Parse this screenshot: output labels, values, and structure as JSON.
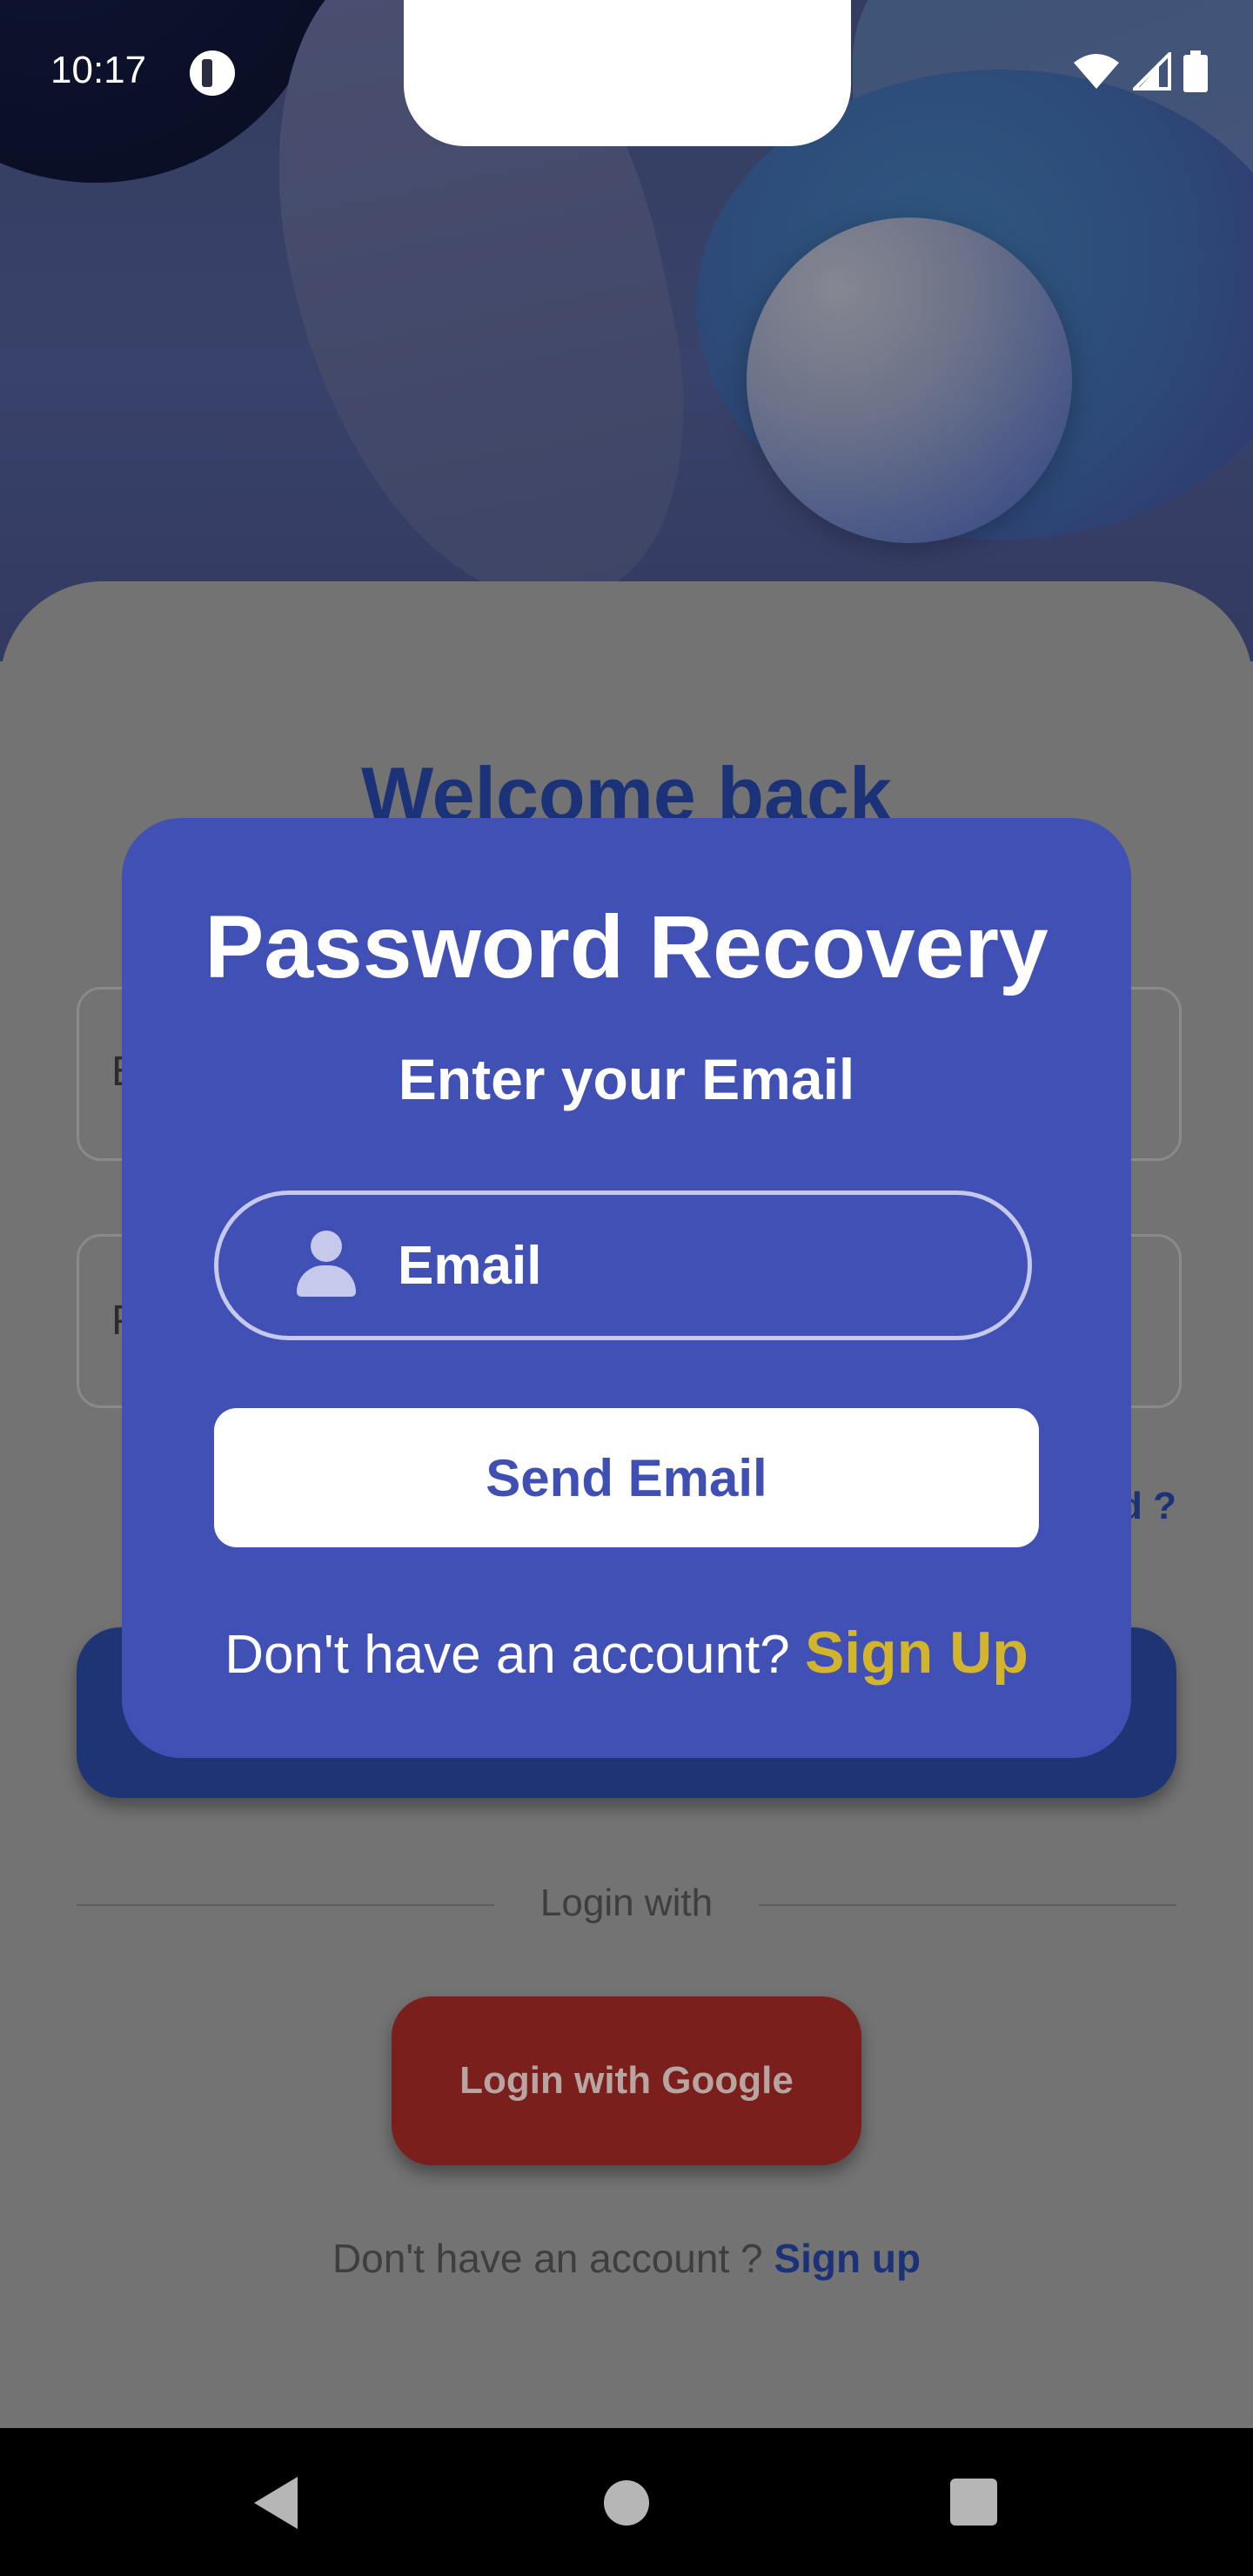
{
  "status_bar": {
    "time": "10:17"
  },
  "login_screen": {
    "welcome_title": "Welcome back",
    "field1_initial": "E",
    "field2_initial": "P",
    "forgot_visible": "d ?",
    "login_with": "Login with",
    "google_button": "Login with Google",
    "no_account_text": "Don't have an account ? ",
    "sign_up_link": "Sign up"
  },
  "modal": {
    "title": "Password Recovery",
    "subtitle": "Enter your Email",
    "email_placeholder": "Email",
    "send_button": "Send Email",
    "footer_text": "Don't have an account? ",
    "footer_link": "Sign Up"
  },
  "colors": {
    "modal_bg": "#4050b5",
    "accent_yellow": "#d2b52a",
    "brand_blue": "#1c3278"
  }
}
